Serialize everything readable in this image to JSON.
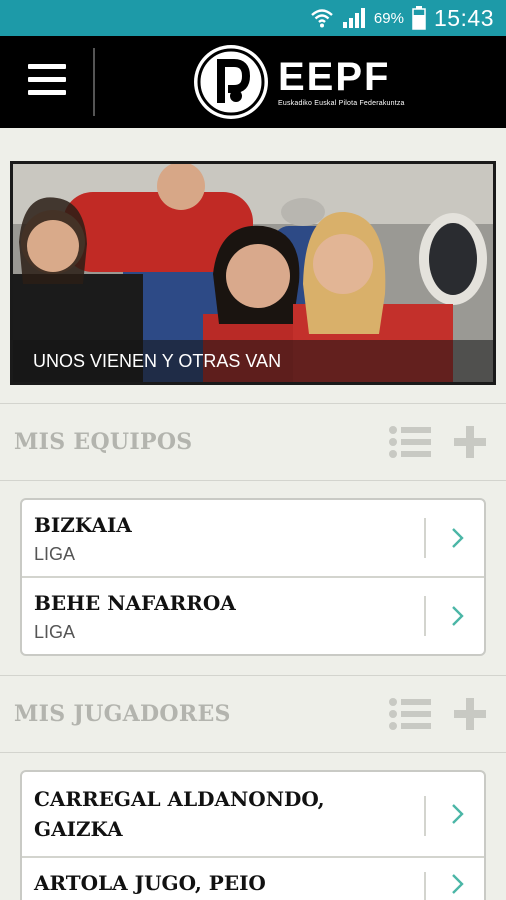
{
  "status_bar": {
    "icons": [
      "wifi-icon",
      "signal-icon",
      "battery-icon"
    ],
    "battery": "69%",
    "time": "15:43",
    "color": "#1d9aa8"
  },
  "header": {
    "menu_icon": "hamburger-menu-icon",
    "logo": {
      "brand": "EEPF",
      "tagline": "Euskadiko Euskal Pilota Federakuntza"
    }
  },
  "hero": {
    "caption": "UNOS VIENEN Y OTRAS VAN"
  },
  "teams_section": {
    "title": "MIS EQUIPOS",
    "items": [
      {
        "name": "BIZKAIA",
        "subtitle": "LIGA"
      },
      {
        "name": "BEHE NAFARROA",
        "subtitle": "LIGA"
      }
    ]
  },
  "players_section": {
    "title": "MIS JUGADORES",
    "items": [
      {
        "name": "CARREGAL ALDANONDO, GAIZKA"
      },
      {
        "name": "ARTOLA JUGO, PEIO"
      }
    ]
  },
  "colors": {
    "accent": "#4bb6a6",
    "background": "#eeefe9",
    "section_title": "#b3b4ae"
  }
}
